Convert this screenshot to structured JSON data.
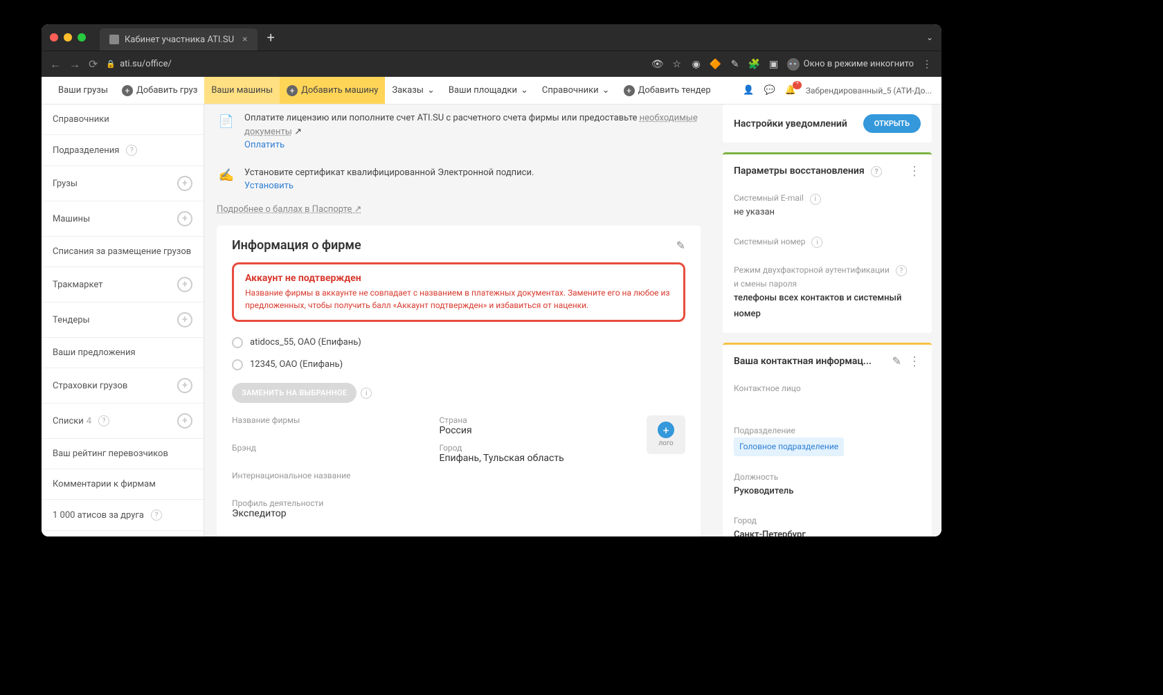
{
  "browser": {
    "tab_title": "Кабинет участника ATI.SU",
    "url": "ati.su/office/",
    "incognito_label": "Окно в режиме инкогнито"
  },
  "topnav": {
    "cargo": "Ваши грузы",
    "add_cargo": "Добавить груз",
    "vehicles": "Ваши машины",
    "add_vehicle": "Добавить машину",
    "orders": "Заказы",
    "platforms": "Ваши площадки",
    "refs": "Справочники",
    "add_tender": "Добавить тендер",
    "user": "Забрендированный_5 (АТИ-До...",
    "notif_count": "7"
  },
  "sidebar": {
    "items": [
      "Справочники",
      "Подразделения",
      "Грузы",
      "Машины",
      "Списания за размещение грузов",
      "Тракмаркет",
      "Тендеры",
      "Ваши предложения",
      "Страховки грузов",
      "Списки",
      "Ваш рейтинг перевозчиков",
      "Комментарии к фирмам",
      "1 000 атисов за друга"
    ],
    "lists_count": "4"
  },
  "tasks": {
    "pay": "Оплатите лицензию или пополните счет ATI.SU с расчетного счета фирмы или предоставьте ",
    "pay_docs": "необходимые документы",
    "pay_link": "Оплатить",
    "cert": "Установите сертификат квалифицированной Электронной подписи.",
    "cert_link": "Установить",
    "more": "Подробнее о баллах в Паспорте"
  },
  "firm": {
    "title": "Информация о фирме",
    "alert_title": "Аккаунт не подтвержден",
    "alert_text": "Название фирмы в аккаунте не совпадает с названием в платежных документах. Замените его на любое из предложенных, чтобы получить балл «Аккаунт подтвержден» и избавиться от наценки.",
    "option1": "atidocs_55, ОАО (Епифань)",
    "option2": "12345, ОАО (Епифань)",
    "replace_btn": "ЗАМЕНИТЬ НА ВЫБРАННОЕ",
    "labels": {
      "name": "Название фирмы",
      "brand": "Брэнд",
      "intl": "Интернациональное название",
      "profile": "Профиль деятельности",
      "country": "Страна",
      "city": "Город"
    },
    "values": {
      "country": "Россия",
      "city": "Епифань, Тульская область",
      "profile": "Экспедитор"
    },
    "logo": "лого"
  },
  "right": {
    "notif_title": "Настройки уведомлений",
    "open": "ОТКРЫТЬ",
    "recovery_title": "Параметры восстановления",
    "email_label": "Системный E-mail",
    "email_val": "не указан",
    "sysnum": "Системный номер",
    "twofa": "Режим двухфакторной аутентификации",
    "twofa2": "и смены пароля",
    "twofa_val": "телефоны всех контактов и системный номер",
    "contact_title": "Ваша контактная информац...",
    "contact_person": "Контактное лицо",
    "dept_label": "Подразделение",
    "dept_val": "Головное подразделение",
    "role_label": "Должность",
    "role_val": "Руководитель",
    "city_label": "Город",
    "city_val": "Санкт-Петербург"
  }
}
